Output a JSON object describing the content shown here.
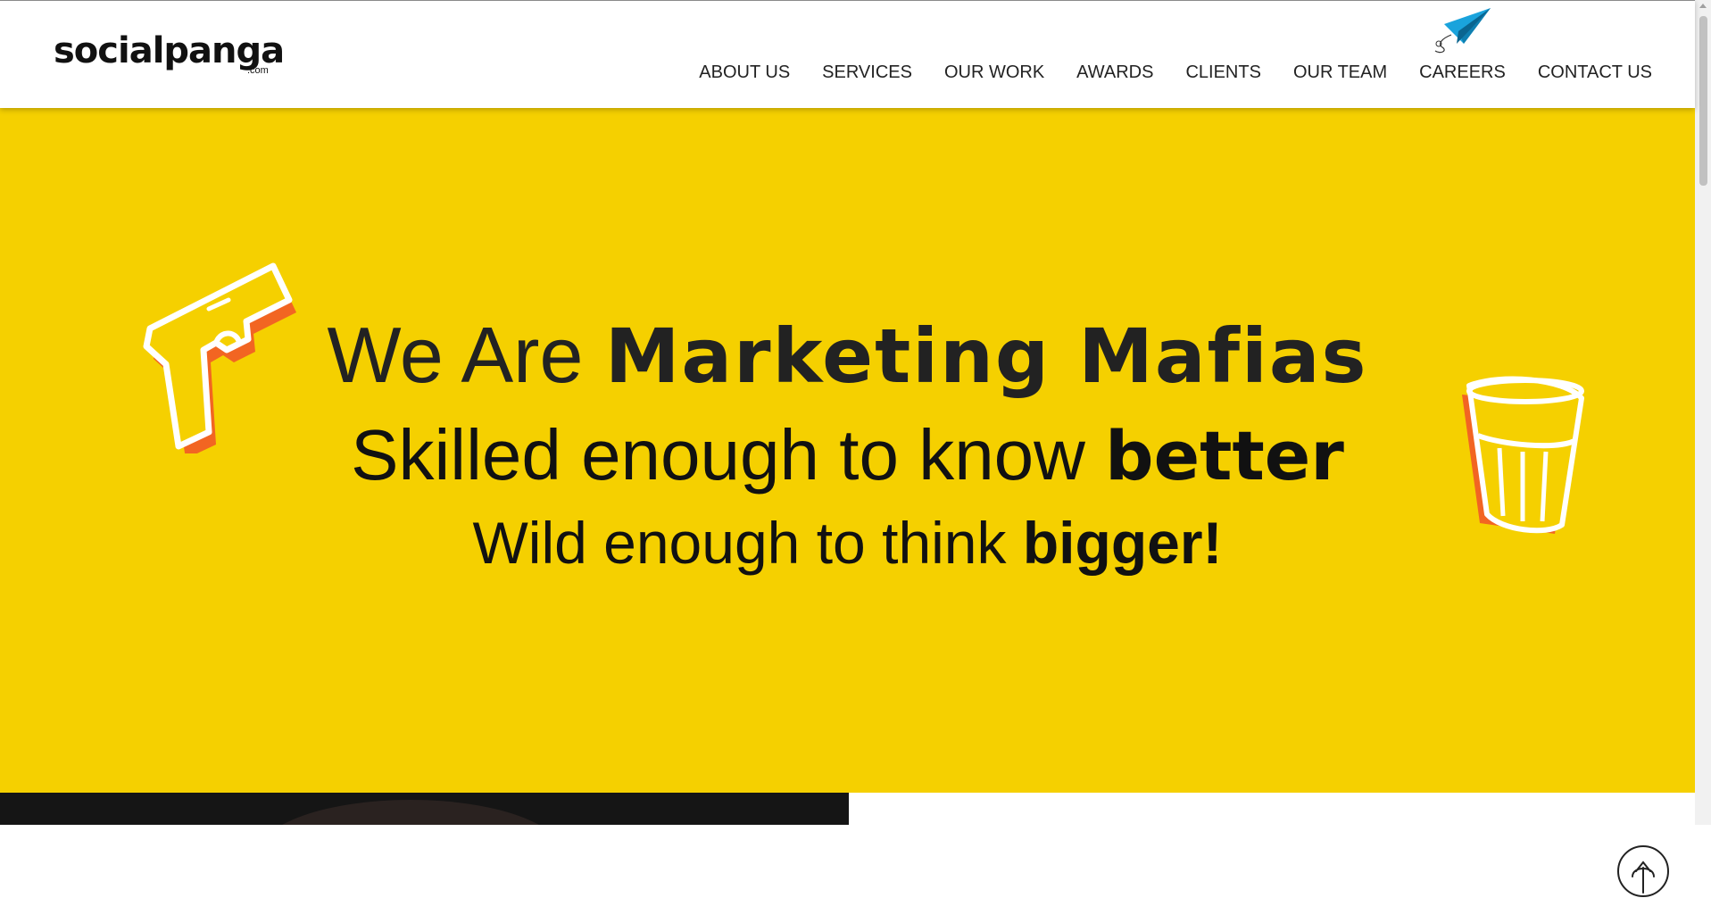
{
  "brand": {
    "name": "socialpanga",
    "suffix": ".com"
  },
  "nav": [
    {
      "label": "ABOUT US"
    },
    {
      "label": "SERVICES"
    },
    {
      "label": "OUR WORK"
    },
    {
      "label": "AWARDS"
    },
    {
      "label": "CLIENTS"
    },
    {
      "label": "OUR TEAM"
    },
    {
      "label": "CAREERS"
    },
    {
      "label": "CONTACT US"
    }
  ],
  "hero": {
    "line1_regular": "We Are ",
    "line1_bold": "Marketing Mafias",
    "line2_regular": "Skilled enough to know ",
    "line2_bold": "better",
    "line3_regular": "Wild enough to think ",
    "line3_bold": "bigger!"
  },
  "colors": {
    "hero_bg": "#f5d000",
    "accent_orange": "#f26522",
    "plane_blue": "#1aa3dc"
  },
  "icons": [
    "paper-plane-icon",
    "pistol-icon",
    "glass-icon",
    "scroll-up-icon"
  ]
}
